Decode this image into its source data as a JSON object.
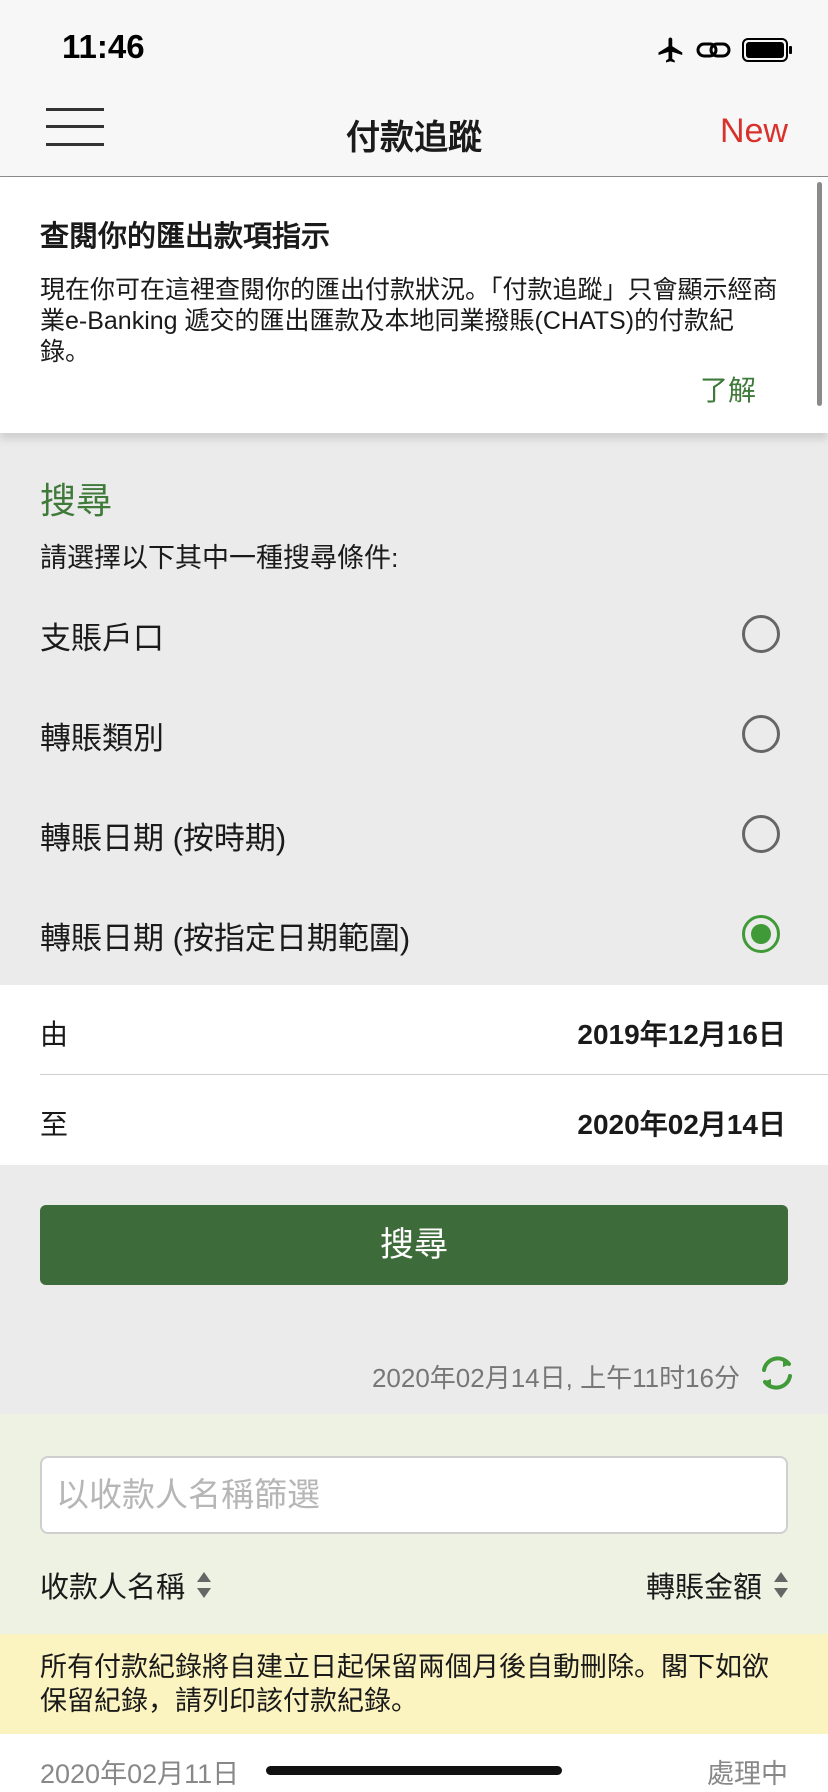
{
  "status_bar": {
    "time": "11:46"
  },
  "nav": {
    "title": "付款追蹤",
    "new_label": "New"
  },
  "info": {
    "title": "查閱你的匯出款項指示",
    "body": "現在你可在這裡查閱你的匯出付款狀況。「付款追蹤」只會顯示經商業e-Banking 遞交的匯出匯款及本地同業撥賬(CHATS)的付款紀錄。",
    "link": "了解"
  },
  "search": {
    "title": "搜尋",
    "prompt": "請選擇以下其中一種搜尋條件:",
    "options": [
      {
        "label": "支賬戶口",
        "selected": false
      },
      {
        "label": "轉賬類別",
        "selected": false
      },
      {
        "label": "轉賬日期 (按時期)",
        "selected": false
      },
      {
        "label": "轉賬日期 (按指定日期範圍)",
        "selected": true
      }
    ],
    "from_label": "由",
    "from_value": "2019年12月16日",
    "to_label": "至",
    "to_value": "2020年02月14日",
    "button": "搜尋"
  },
  "refresh": {
    "timestamp": "2020年02月14日, 上午11时16分"
  },
  "results": {
    "filter_placeholder": "以收款人名稱篩選",
    "col_payee": "收款人名稱",
    "col_amount": "轉賬金額",
    "notice": "所有付款紀錄將自建立日起保留兩個月後自動刪除。閣下如欲保留紀錄，請列印該付款紀錄。",
    "rows": [
      {
        "date": "2020年02月11日",
        "status": "處理中"
      }
    ]
  },
  "colors": {
    "accent_green": "#3f7a3a",
    "button_green": "#3e6b3a",
    "new_red": "#d9322c",
    "notice_yellow": "#fbf3c0"
  }
}
